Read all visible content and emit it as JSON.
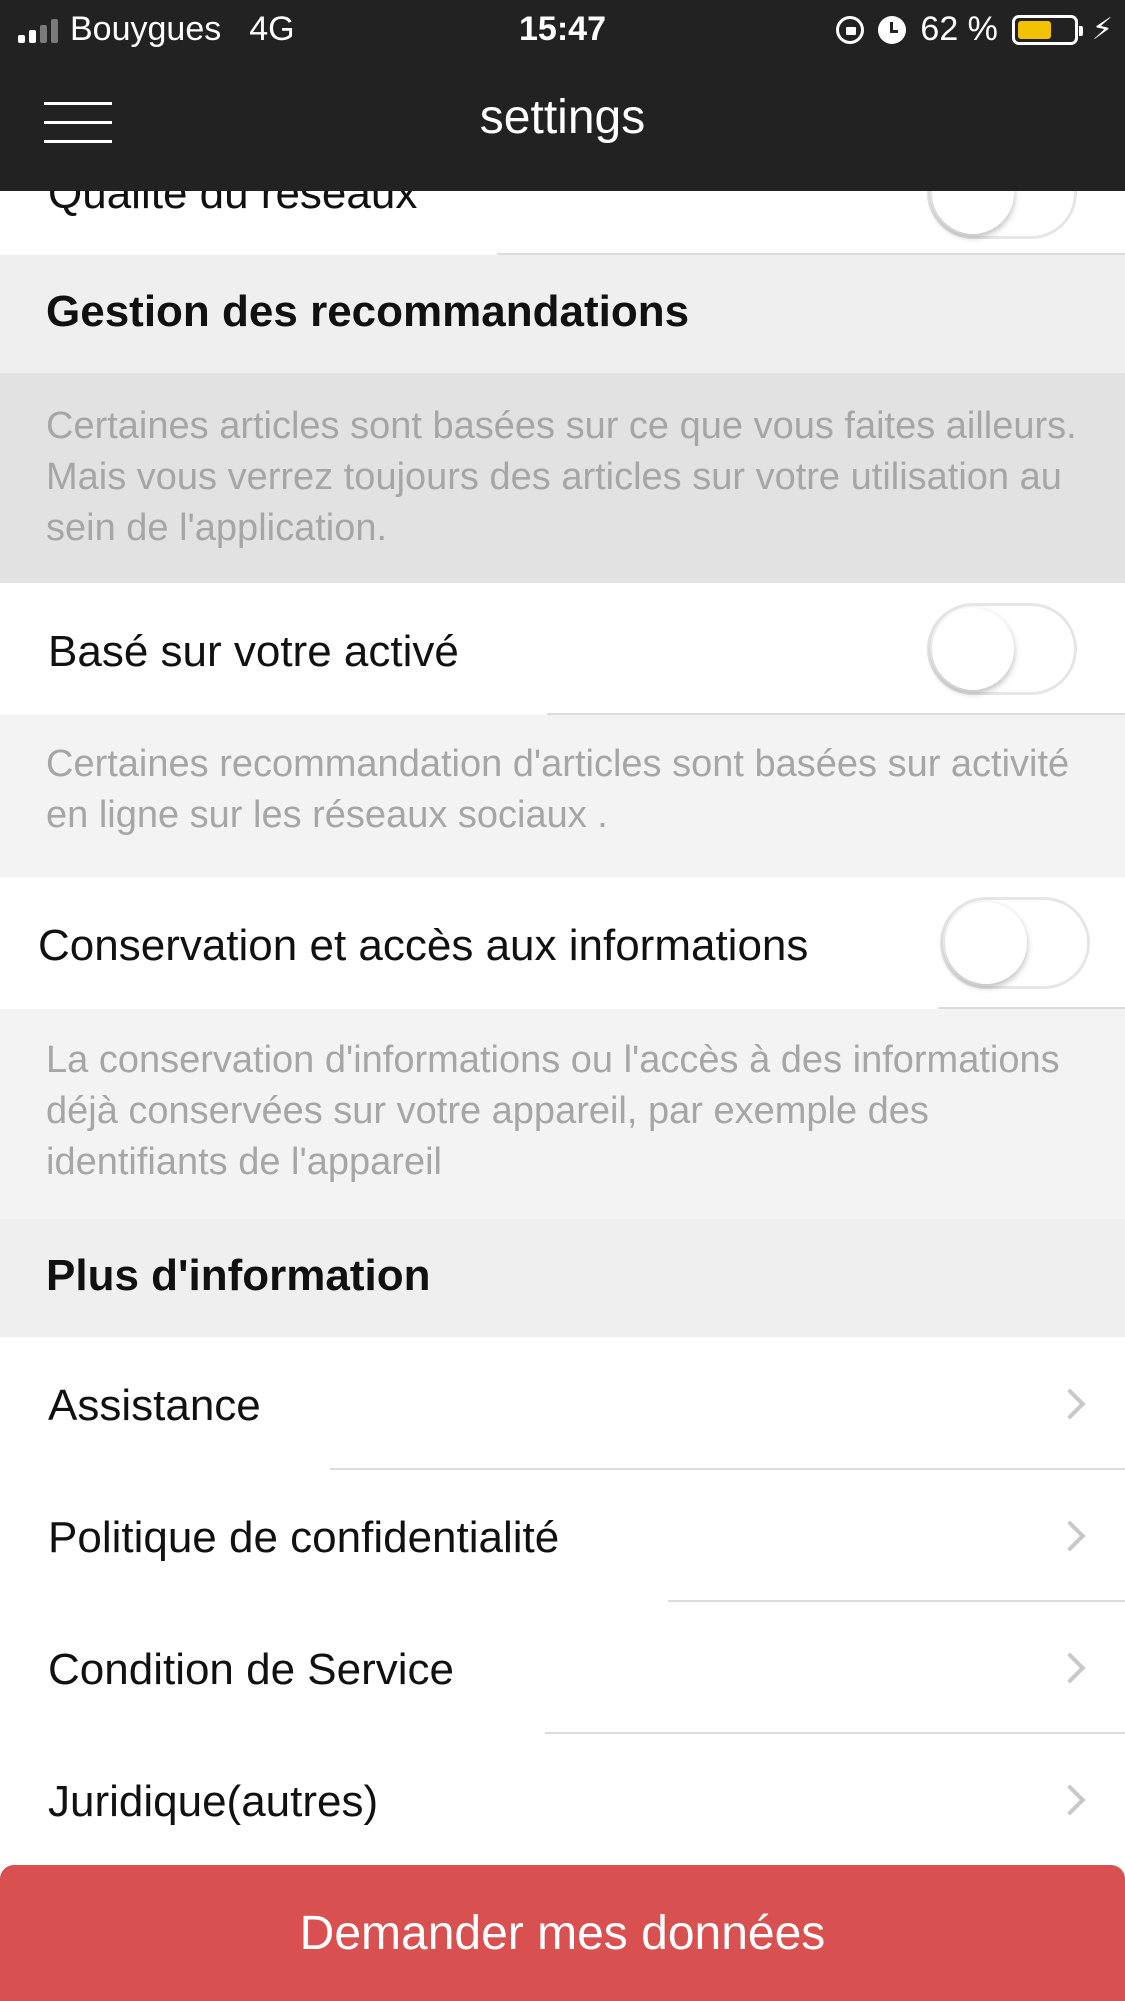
{
  "status_bar": {
    "carrier": "Bouygues",
    "network": "4G",
    "time": "15:47",
    "battery_text": "62 %",
    "battery_level": 0.62,
    "icons": [
      "signal-icon",
      "rotation-lock-icon",
      "alarm-icon",
      "battery-icon",
      "charging-bolt-icon"
    ]
  },
  "nav": {
    "title": "settings",
    "menu_icon": "hamburger-menu-icon"
  },
  "rows": {
    "network_quality": {
      "label": "Qualité du réseaux",
      "toggle_on": false
    },
    "activity_based": {
      "label": "Basé sur votre activé",
      "toggle_on": false
    },
    "storage_access": {
      "label": "Conservation et accès aux informations",
      "toggle_on": false
    }
  },
  "sections": {
    "recommendations": {
      "title": "Gestion des recommandations",
      "description": "Certaines articles sont basées sur ce que vous faites ailleurs. Mais vous verrez toujours des articles sur votre utilisation au sein de l'application."
    },
    "activity_desc": "Certaines recommandation d'articles sont basées sur activité en ligne sur les réseaux sociaux .",
    "storage_desc": "La conservation d'informations ou l'accès à des informations déjà conservées sur votre appareil, par exemple des identifiants de l'appareil",
    "more_info": {
      "title": "Plus d'information",
      "items": [
        {
          "label": "Assistance"
        },
        {
          "label": "Politique de confidentialité"
        },
        {
          "label": "Condition de Service"
        },
        {
          "label": "Juridique(autres)"
        }
      ]
    }
  },
  "cta": {
    "label": "Demander mes données"
  },
  "colors": {
    "nav_bg": "#222222",
    "cta_bg": "#d95050",
    "battery": "#f2c100",
    "section_bg": "#efefef",
    "muted_text": "#a6a6a6"
  }
}
